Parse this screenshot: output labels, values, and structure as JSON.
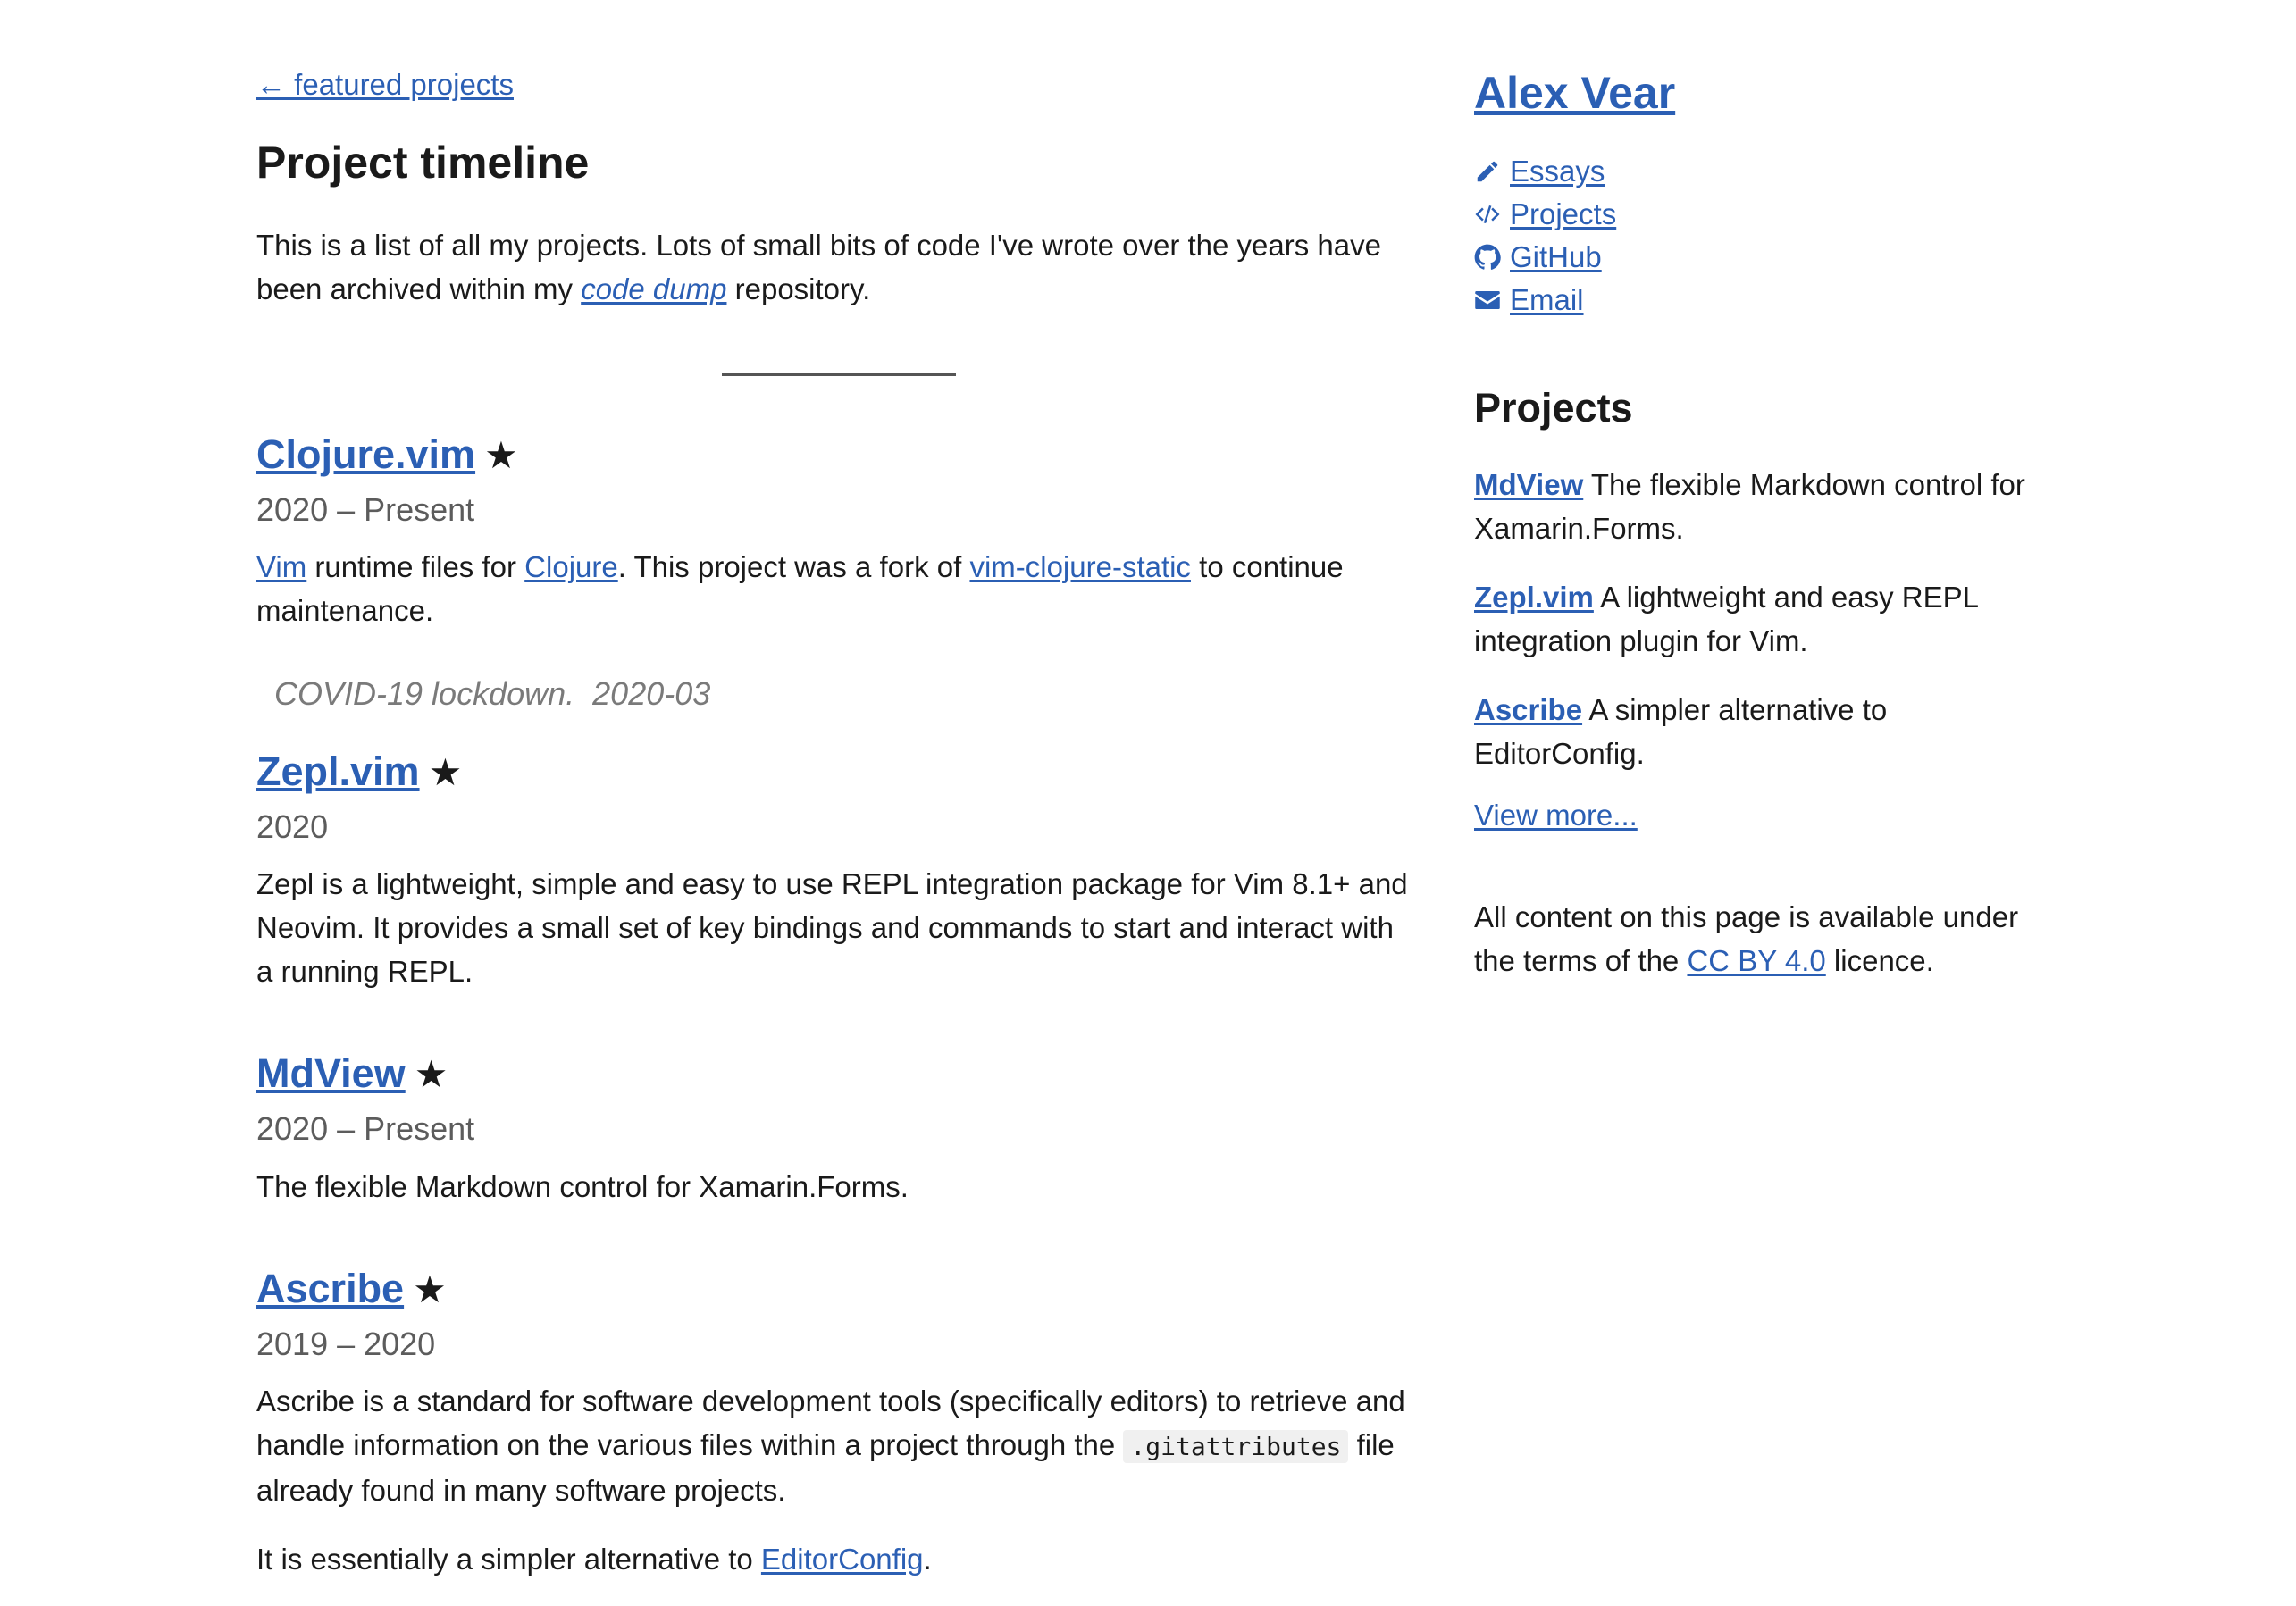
{
  "main": {
    "back_link": "← featured projects",
    "title": "Project timeline",
    "intro_before": "This is a list of all my projects.  Lots of small bits of code I've wrote over the years have been archived within my ",
    "intro_link": "code dump",
    "intro_after": " repository.",
    "star": "★",
    "projects": [
      {
        "title": "Clojure.vim",
        "date": "2020 – Present",
        "desc_link1": "Vim",
        "desc_text1": " runtime files for ",
        "desc_link2": "Clojure",
        "desc_text2": ".  This project was a fork of ",
        "desc_link3": "vim-clojure-static",
        "desc_text3": " to continue maintenance."
      },
      {
        "title": "Zepl.vim",
        "date": "2020",
        "desc": "Zepl is a lightweight, simple and easy to use REPL integration package for Vim 8.1+ and Neovim.  It provides a small set of key bindings and commands to start and interact with a running REPL."
      },
      {
        "title": "MdView",
        "date": "2020 – Present",
        "desc": "The flexible Markdown control for Xamarin.Forms."
      },
      {
        "title": "Ascribe",
        "date": "2019 – 2020",
        "desc_before": "Ascribe is a standard for software development tools (specifically editors) to retrieve and handle information on the various files within a project through the ",
        "desc_code": ".gitattributes",
        "desc_after": " file already found in many software projects.",
        "desc2_before": "It is essentially a simpler alternative to ",
        "desc2_link": "EditorConfig",
        "desc2_after": "."
      }
    ],
    "milestone": {
      "text": "COVID-19 lockdown.",
      "date": "2020-03"
    }
  },
  "sidebar": {
    "name": "Alex Vear",
    "nav": [
      {
        "label": "Essays",
        "icon": "pencil-icon"
      },
      {
        "label": "Projects",
        "icon": "code-icon"
      },
      {
        "label": "GitHub",
        "icon": "github-icon"
      },
      {
        "label": "Email",
        "icon": "envelope-icon"
      }
    ],
    "projects_heading": "Projects",
    "projects": [
      {
        "name": "MdView",
        "desc": " The flexible Markdown control for Xamarin.Forms."
      },
      {
        "name": "Zepl.vim",
        "desc": " A lightweight and easy REPL integration plugin for Vim."
      },
      {
        "name": "Ascribe",
        "desc": " A simpler alternative to EditorConfig."
      }
    ],
    "view_more": "View more...",
    "license_before": "All content on this page is available under the terms of the ",
    "license_link": "CC BY 4.0",
    "license_after": " licence."
  },
  "colors": {
    "link": "#2b5fb4",
    "text": "#1a1a1a",
    "muted": "#5c5c5c"
  }
}
